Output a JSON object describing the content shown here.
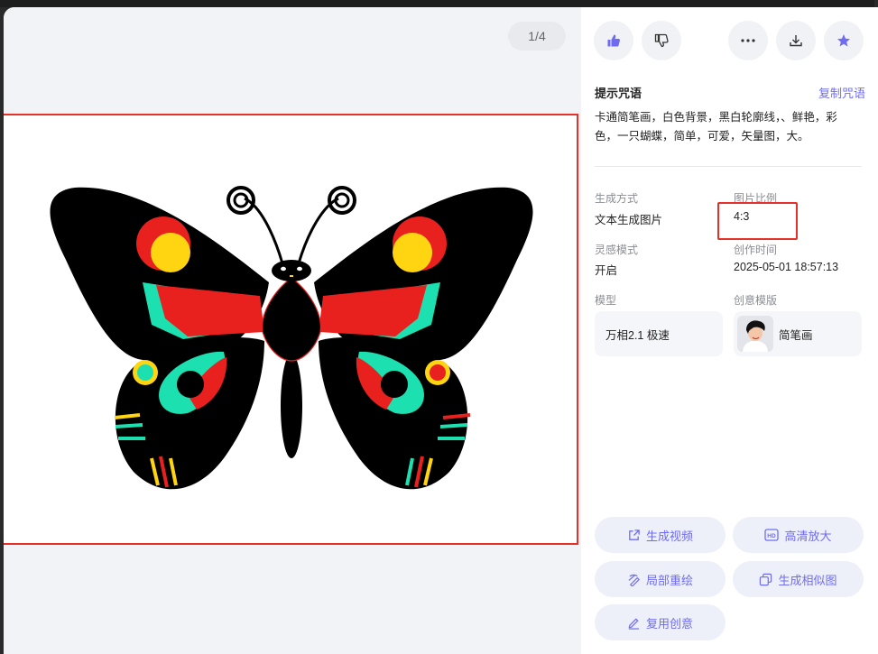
{
  "preview": {
    "page_counter": "1/4"
  },
  "toolbar": {
    "like_icon": "thumbs-up-icon",
    "dislike_icon": "thumbs-down-icon",
    "more_icon": "more-icon",
    "download_icon": "download-icon",
    "favorite_icon": "star-icon",
    "accent_color": "#6f6cf0"
  },
  "prompt": {
    "title": "提示咒语",
    "copy_label": "复制咒语",
    "line1": "卡通简笔画，白色背景，黑白轮廓线，、鲜艳，彩",
    "line2": "色，一只蝴蝶，简单，可爱，矢量图，大。"
  },
  "meta": {
    "gen_method_label": "生成方式",
    "gen_method_value": "文本生成图片",
    "ratio_label": "图片比例",
    "ratio_value": "4:3",
    "inspiration_label": "灵感模式",
    "inspiration_value": "开启",
    "created_label": "创作时间",
    "created_value": "2025-05-01 18:57:13",
    "model_label": "模型",
    "model_value": "万相2.1 极速",
    "template_label": "创意模版",
    "template_value": "简笔画"
  },
  "actions": {
    "generate_video": "生成视频",
    "hd_upscale": "高清放大",
    "partial_redraw": "局部重绘",
    "similar": "生成相似图",
    "reuse": "复用创意"
  }
}
